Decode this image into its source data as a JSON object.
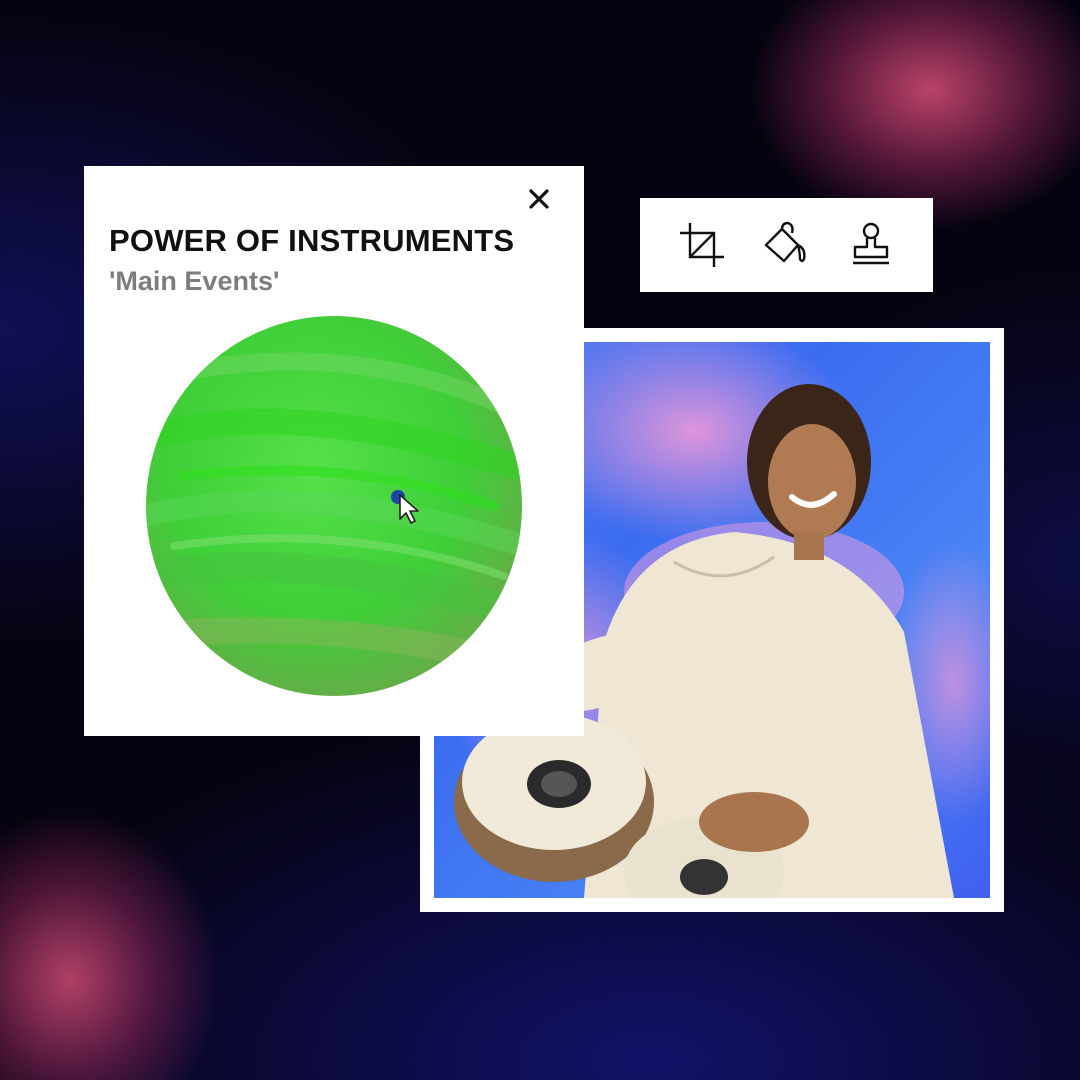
{
  "popup": {
    "title": "POWER OF INSTRUMENTS",
    "subtitle": "'Main Events'",
    "close_icon": "close-icon",
    "planet_color": "#3fd43a"
  },
  "toolbar": {
    "tools": [
      {
        "name": "crop",
        "icon": "crop-icon"
      },
      {
        "name": "fill",
        "icon": "paint-bucket-icon"
      },
      {
        "name": "stamp",
        "icon": "stamp-icon"
      }
    ]
  },
  "photo": {
    "subject": "musician-playing-tabla-photo"
  },
  "colors": {
    "background": "#05030f",
    "accent_pink": "#c4466e",
    "accent_blue": "#141470",
    "planet_green": "#3fd43a",
    "cursor_dot": "#1a46a8"
  }
}
